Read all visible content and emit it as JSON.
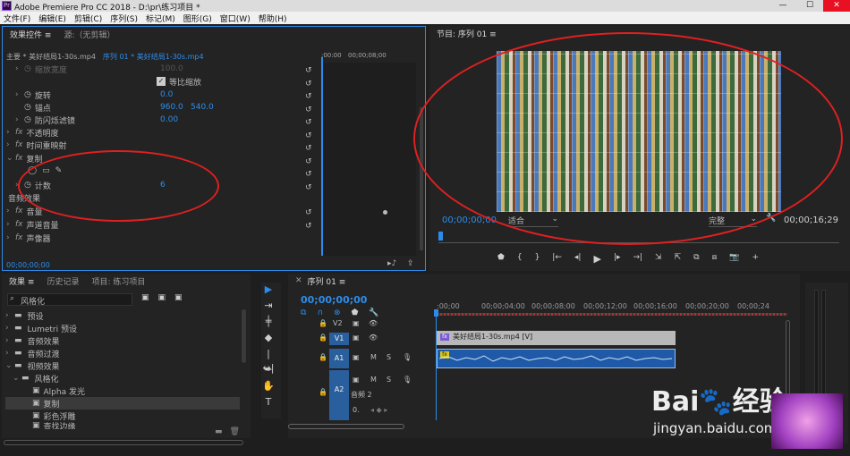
{
  "window": {
    "title": "Adobe Premiere Pro CC 2018 - D:\\pr\\练习项目 *",
    "logo": "Pr"
  },
  "menu": [
    "文件(F)",
    "编辑(E)",
    "剪辑(C)",
    "序列(S)",
    "标记(M)",
    "图形(G)",
    "窗口(W)",
    "帮助(H)"
  ],
  "effect_controls": {
    "tab_active": "效果控件",
    "tab_menu": "≡",
    "tab_source": "源:（无剪辑）",
    "master_label": "主要 * 美好结局1-30s.mp4",
    "sequence_label": "序列 01 * 美好结局1-30s.mp4",
    "timecode_start": ":00:00",
    "timecode_mid": "00;00;08;00",
    "props": {
      "scale_width_label": "缩放宽度",
      "scale_width_value": "100.0",
      "uniform_scale_label": "等比缩放",
      "rotation_label": "旋转",
      "rotation_value": "0.0",
      "anchor_label": "锚点",
      "anchor_x": "960.0",
      "anchor_y": "540.0",
      "flicker_label": "防闪烁滤镜",
      "flicker_value": "0.00",
      "opacity_label": "不透明度",
      "time_remap_label": "时间重映射",
      "replicate_label": "复制",
      "count_label": "计数",
      "count_value": "6",
      "audio_effects_label": "音频效果",
      "volume_label": "音量",
      "channel_volume_label": "声道音量",
      "panner_label": "声像器"
    },
    "bottom_timecode": "00;00;00;00"
  },
  "program": {
    "title": "节目: 序列 01",
    "menu": "≡",
    "timecode": "00;00;00;00",
    "fit": "适合",
    "quality": "完整",
    "duration": "00;00;16;29"
  },
  "effects": {
    "tab_active": "效果",
    "tab_menu": "≡",
    "tab_history": "历史记录",
    "tab_project": "项目: 练习项目",
    "search_value": "风格化",
    "tree": [
      {
        "label": "预设",
        "level": 0
      },
      {
        "label": "Lumetri 预设",
        "level": 0
      },
      {
        "label": "音频效果",
        "level": 0
      },
      {
        "label": "音频过渡",
        "level": 0
      },
      {
        "label": "视频效果",
        "level": 0
      },
      {
        "label": "风格化",
        "level": 1
      },
      {
        "label": "Alpha 发光",
        "level": 2
      },
      {
        "label": "复制",
        "level": 2
      },
      {
        "label": "彩色浮雕",
        "level": 2
      },
      {
        "label": "查找边缘",
        "level": 2
      }
    ]
  },
  "timeline": {
    "tab": "序列 01",
    "menu": "≡",
    "timecode": "00;00;00;00",
    "ruler": [
      ":00;00",
      "00;00;04;00",
      "00;00;08;00",
      "00;00;12;00",
      "00;00;16;00",
      "00;00;20;00",
      "00;00;24"
    ],
    "tracks": {
      "v2": "V2",
      "v1": "V1",
      "a1": "A1",
      "a2": "A2",
      "a2_name": "音频 2",
      "a2_vol": "0."
    },
    "track_buttons": {
      "m": "M",
      "s": "S"
    },
    "video_clip": "美好结局1-30s.mp4 [V]",
    "audio_clip_fx": "fx",
    "video_clip_fx": "fx"
  },
  "watermark": {
    "brand": "Bai",
    "brand_tail": "经验",
    "url": "jingyan.baidu.com"
  },
  "colors": {
    "accent": "#2d8ceb",
    "annotation": "#e02020",
    "audio_clip": "#1f5aa8",
    "video_clip": "#b8b8b8"
  }
}
